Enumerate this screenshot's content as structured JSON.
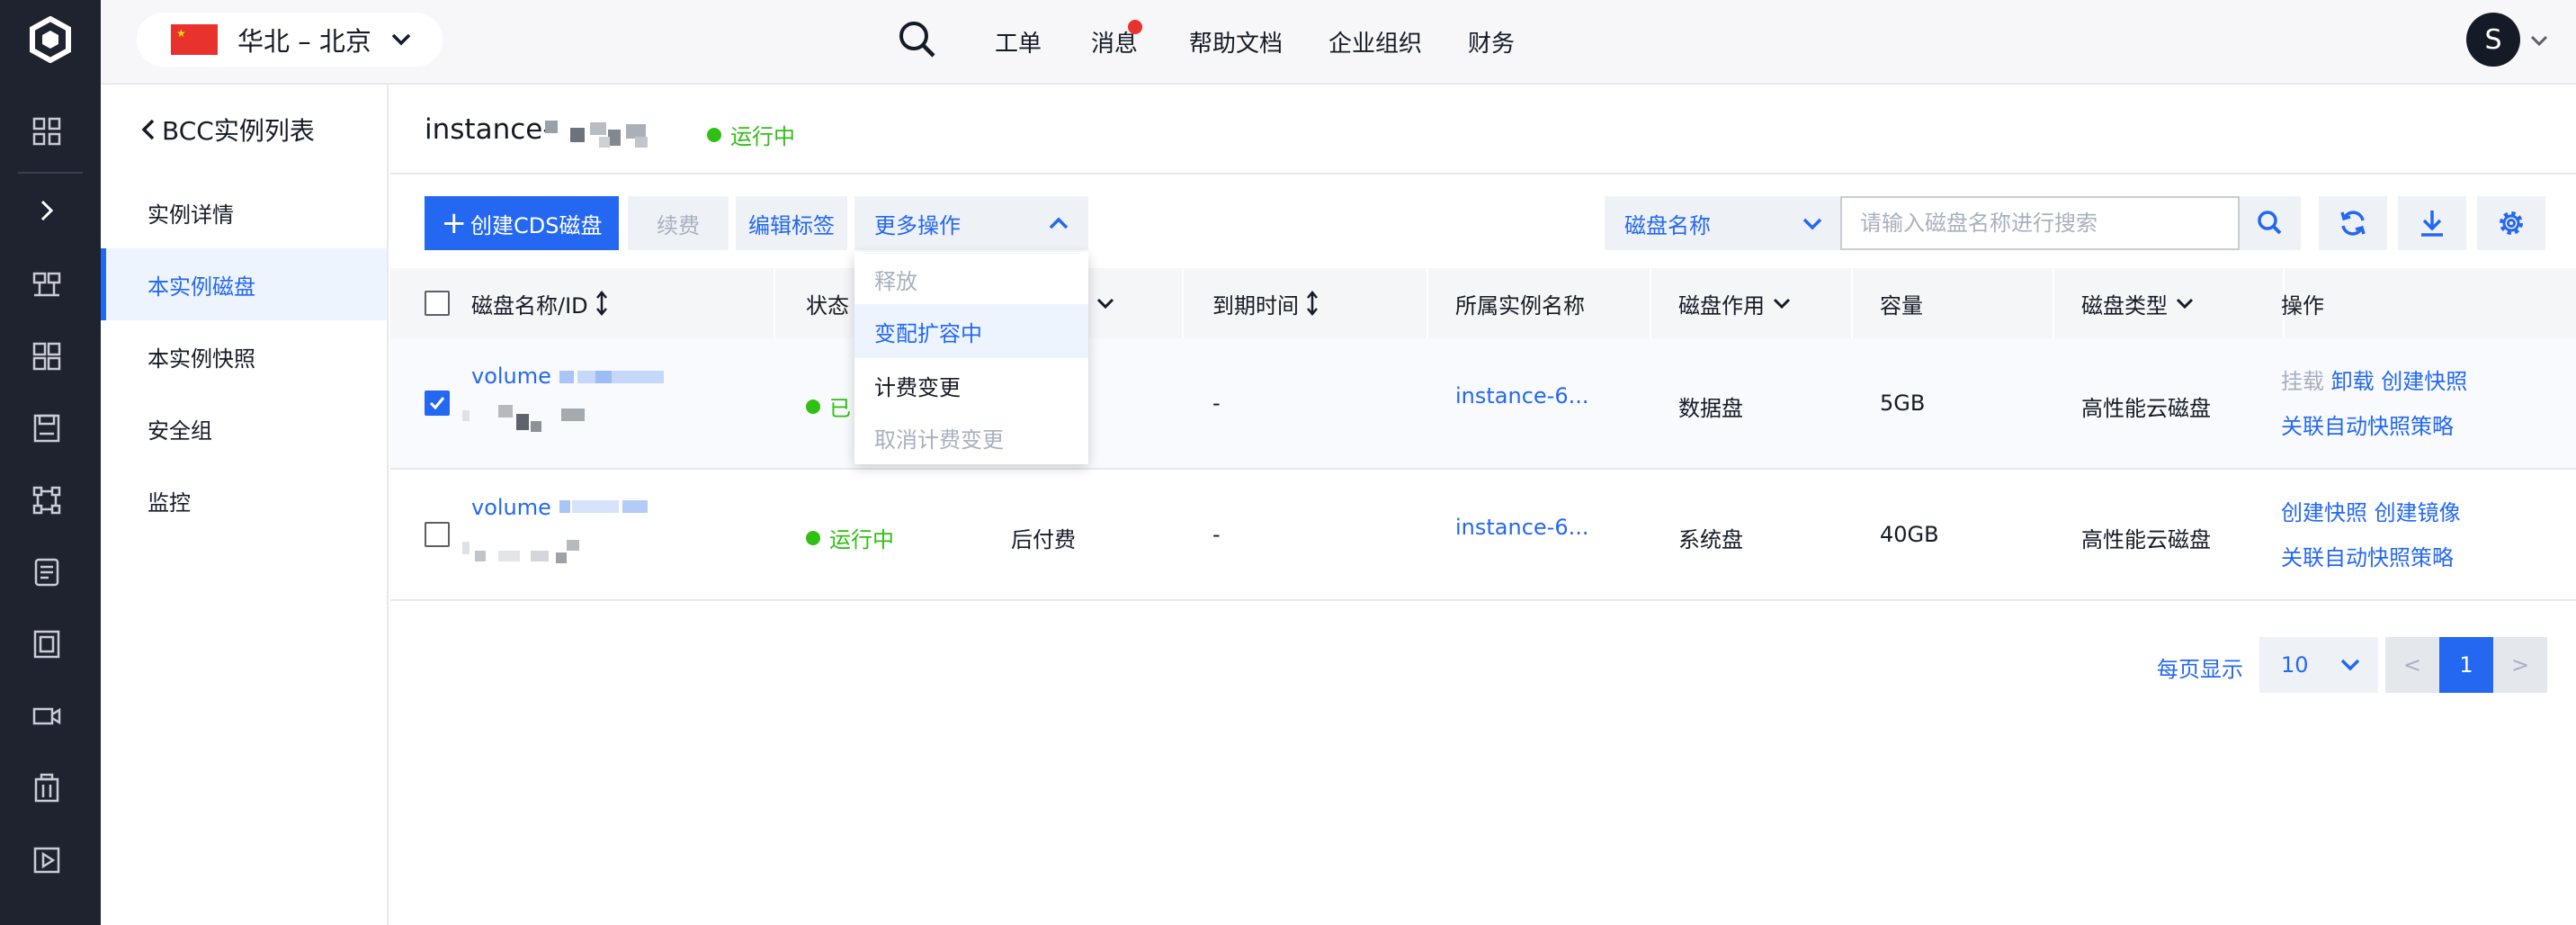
{
  "header": {
    "region": "华北 – 北京",
    "nav": [
      "工单",
      "消息",
      "帮助文档",
      "企业组织",
      "财务"
    ],
    "avatar_letter": "S"
  },
  "sidebar": {
    "back_label": "BCC实例列表",
    "items": [
      "实例详情",
      "本实例磁盘",
      "本实例快照",
      "安全组",
      "监控"
    ],
    "active_index": 1
  },
  "instance": {
    "title_prefix": "instance-",
    "status": "运行中"
  },
  "toolbar": {
    "create_label": "创建CDS磁盘",
    "renew_label": "续费",
    "edit_tags_label": "编辑标签",
    "more_label": "更多操作",
    "filter_select": "磁盘名称",
    "search_placeholder": "请输入磁盘名称进行搜索"
  },
  "more_menu": {
    "items": [
      "释放",
      "变配扩容中",
      "计费变更",
      "取消计费变更"
    ]
  },
  "table": {
    "headers": [
      "磁盘名称/ID",
      "状态",
      "",
      "到期时间",
      "所属实例名称",
      "磁盘作用",
      "容量",
      "磁盘类型",
      "操作"
    ],
    "rows": [
      {
        "name_prefix": "volume",
        "status": "已",
        "billing": "",
        "expire": "-",
        "instance": "instance-6...",
        "role": "数据盘",
        "capacity": "5GB",
        "type": "高性能云磁盘",
        "op1": "挂载",
        "op2": "卸载",
        "op3": "创建快照",
        "op4": "关联自动快照策略",
        "checked": true
      },
      {
        "name_prefix": "volume",
        "status": "运行中",
        "billing": "后付费",
        "expire": "-",
        "instance": "instance-6...",
        "role": "系统盘",
        "capacity": "40GB",
        "type": "高性能云磁盘",
        "op1": "创建快照",
        "op2": "创建镜像",
        "op4": "关联自动快照策略",
        "checked": false
      }
    ]
  },
  "pagination": {
    "per_page_label": "每页显示",
    "page_size": "10",
    "current_page": "1",
    "prev": "<",
    "next": ">"
  },
  "colors": {
    "accent": "#2468f2",
    "running": "#30bf13",
    "rail": "#1f2330"
  }
}
